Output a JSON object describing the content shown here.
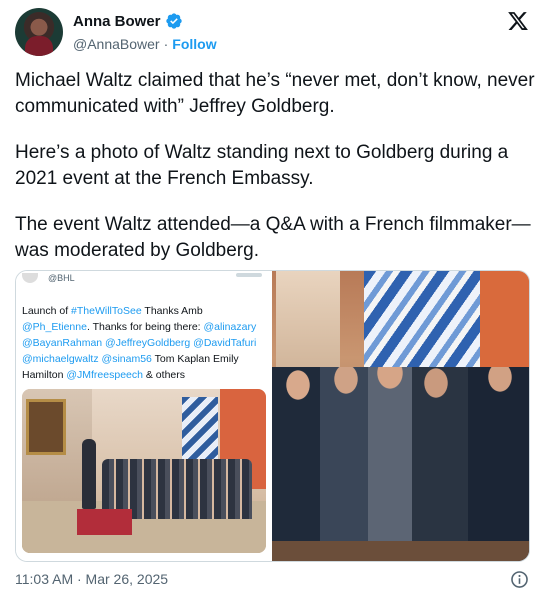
{
  "author": {
    "name": "Anna Bower",
    "handle": "@AnnaBower",
    "separator": "·",
    "follow_label": "Follow"
  },
  "tweet": {
    "paragraphs": [
      "Michael Waltz claimed that he’s “never met, don’t know, never communicated with” Jeffrey Goldberg.",
      "Here’s a photo of Waltz standing next to Goldberg during a 2021 event at the French Embassy.",
      "The event Waltz attended—a Q&A with a French filmmaker—was moderated by Goldberg."
    ],
    "timestamp": "11:03 AM · Mar 26, 2025"
  },
  "embedded_screenshot": {
    "handle": "@BHL",
    "text_parts": [
      {
        "t": "Launch of ",
        "link": false
      },
      {
        "t": "#TheWillToSee",
        "link": true
      },
      {
        "t": " Thanks Amb ",
        "link": false
      },
      {
        "t": "@Ph_Etienne",
        "link": true
      },
      {
        "t": ". Thanks for being there: ",
        "link": false
      },
      {
        "t": "@alinazary",
        "link": true
      },
      {
        "t": " ",
        "link": false
      },
      {
        "t": "@BayanRahman",
        "link": true
      },
      {
        "t": " ",
        "link": false
      },
      {
        "t": "@JeffreyGoldberg",
        "link": true
      },
      {
        "t": " ",
        "link": false
      },
      {
        "t": "@DavidTafuri",
        "link": true
      },
      {
        "t": " ",
        "link": false
      },
      {
        "t": "@michaelgwaltz",
        "link": true
      },
      {
        "t": " ",
        "link": false
      },
      {
        "t": "@sinam56",
        "link": true
      },
      {
        "t": " Tom Kaplan Emily Hamilton ",
        "link": false
      },
      {
        "t": "@JMfreespeech",
        "link": true
      },
      {
        "t": " & others",
        "link": false
      }
    ]
  },
  "colors": {
    "link": "#1d9bf0",
    "text": "#0f1419",
    "muted": "#536471",
    "verified": "#1d9bf0"
  },
  "icons": [
    "verified-badge-icon",
    "x-logo-icon",
    "info-icon"
  ]
}
